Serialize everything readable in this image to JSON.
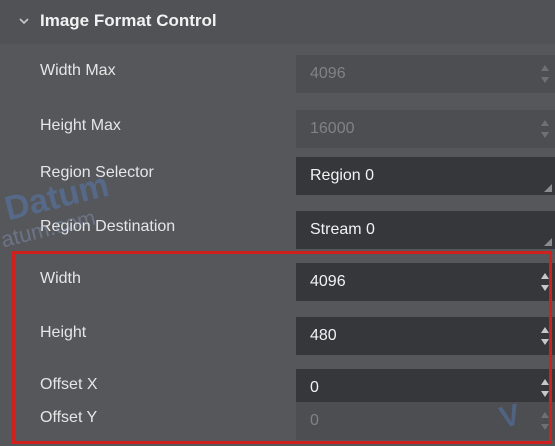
{
  "section": {
    "title": "Image Format Control",
    "expand_icon": "chevron-down-icon"
  },
  "rows": [
    {
      "label": "Width Max",
      "value": "4096",
      "enabled": false,
      "control": "spinbox"
    },
    {
      "label": "Height Max",
      "value": "16000",
      "enabled": false,
      "control": "spinbox"
    },
    {
      "label": "Region Selector",
      "value": "Region 0",
      "enabled": true,
      "control": "dropdown"
    },
    {
      "label": "Region Destination",
      "value": "Stream 0",
      "enabled": true,
      "control": "dropdown"
    },
    {
      "label": "Width",
      "value": "4096",
      "enabled": true,
      "control": "spinbox"
    },
    {
      "label": "Height",
      "value": "480",
      "enabled": true,
      "control": "spinbox"
    },
    {
      "label": "Offset X",
      "value": "0",
      "enabled": true,
      "control": "spinbox"
    },
    {
      "label": "Offset Y",
      "value": "0",
      "enabled": false,
      "control": "spinbox"
    }
  ],
  "watermark": {
    "text1": "Datum",
    "text2": "atum.com",
    "text3": "V"
  },
  "colors": {
    "highlight": "#d0201e",
    "panel_bg": "#55575b",
    "field_bg": "#35373b"
  }
}
